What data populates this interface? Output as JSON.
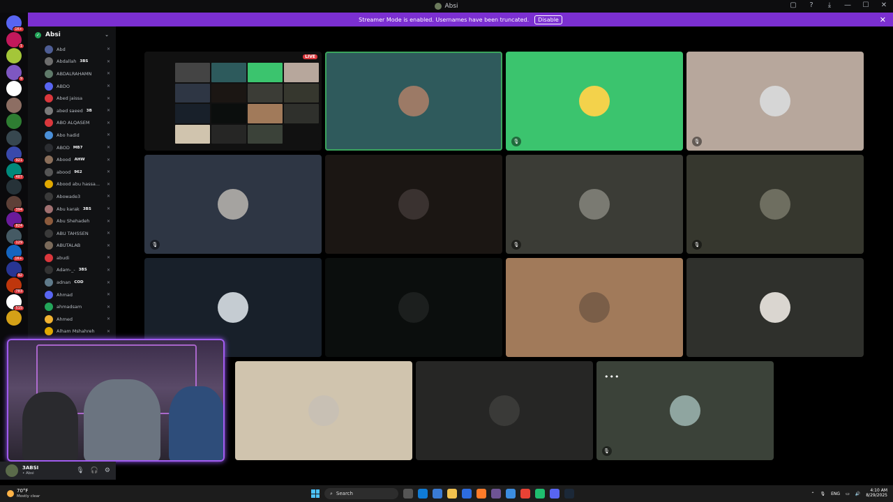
{
  "window": {
    "title": "Absi",
    "controls": [
      "▢",
      "?",
      "⤓",
      "—",
      "☐",
      "✕"
    ]
  },
  "banner": {
    "message": "Streamer Mode is enabled. Usernames have been truncated.",
    "disable_label": "Disable",
    "close": "✕"
  },
  "server_rail": [
    {
      "badge": "1K+",
      "color": "#5865f2"
    },
    {
      "badge": "1",
      "color": "#c2185b"
    },
    {
      "badge": "",
      "color": "#a4c639"
    },
    {
      "badge": "9",
      "color": "#7e57c2"
    },
    {
      "badge": "",
      "color": "#ffffff"
    },
    {
      "badge": "",
      "color": "#8d6e63"
    },
    {
      "badge": "",
      "color": "#2e7d32"
    },
    {
      "badge": "",
      "color": "#37474f"
    },
    {
      "badge": "921",
      "color": "#3949ab"
    },
    {
      "badge": "487",
      "color": "#00897b"
    },
    {
      "badge": "",
      "color": "#263238"
    },
    {
      "badge": "394",
      "color": "#5d4037"
    },
    {
      "badge": "824",
      "color": "#6a1b9a"
    },
    {
      "badge": "129",
      "color": "#455a64"
    },
    {
      "badge": "1K+",
      "color": "#1565c0"
    },
    {
      "badge": "92",
      "color": "#283593"
    },
    {
      "badge": "783",
      "color": "#bf360c"
    },
    {
      "badge": "515",
      "color": "#ffffff"
    },
    {
      "badge": "",
      "color": "#d4a017"
    }
  ],
  "server": {
    "name": "Absi",
    "check": "✓",
    "chevron": "⌄"
  },
  "members": [
    {
      "name": "Abd",
      "tag": "",
      "color": "#4e5d94"
    },
    {
      "name": "Abdallah",
      "tag": "3BS",
      "color": "#6d6d6d"
    },
    {
      "name": "ABDALRAHAMN",
      "tag": "",
      "color": "#5f7a6a"
    },
    {
      "name": "ABDO",
      "tag": "",
      "color": "#5865f2"
    },
    {
      "name": "Abed jaissa",
      "tag": "",
      "color": "#da373c"
    },
    {
      "name": "abed saeed",
      "tag": "3B",
      "color": "#7a7a7a"
    },
    {
      "name": "ABO ALQASEM",
      "tag": "",
      "color": "#da373c"
    },
    {
      "name": "Abo hadid",
      "tag": "",
      "color": "#4a8fd8"
    },
    {
      "name": "ABOD",
      "tag": "MB7",
      "color": "#2b2d31"
    },
    {
      "name": "Abood",
      "tag": "AHW",
      "color": "#8a6e5a"
    },
    {
      "name": "abood",
      "tag": "962",
      "color": "#555"
    },
    {
      "name": "Abood abu hassa...",
      "tag": "",
      "color": "#e0a800"
    },
    {
      "name": "Abowade3",
      "tag": "",
      "color": "#3a3a3a"
    },
    {
      "name": "Abu karak",
      "tag": "3BS",
      "color": "#a07070"
    },
    {
      "name": "Abu Shehadeh",
      "tag": "",
      "color": "#8b5a3c"
    },
    {
      "name": "ABU TAHSSEN",
      "tag": "",
      "color": "#3a3a3a"
    },
    {
      "name": "ABUTALAB",
      "tag": "",
      "color": "#7a6a5a"
    },
    {
      "name": "abudi",
      "tag": "",
      "color": "#da373c"
    },
    {
      "name": "Adam-_-",
      "tag": "3BS",
      "color": "#333"
    },
    {
      "name": "adnan",
      "tag": "COD",
      "color": "#5f7a8a"
    },
    {
      "name": "Ahmad",
      "tag": "",
      "color": "#5865f2"
    },
    {
      "name": "ahmadsam",
      "tag": "",
      "color": "#23a55a"
    },
    {
      "name": "Ahmed",
      "tag": "",
      "color": "#f0b232"
    },
    {
      "name": "Alham Mshahreh",
      "tag": "",
      "color": "#e0a800"
    }
  ],
  "user": {
    "name": "3ABSI",
    "status": "• Absi",
    "mic": "🎙",
    "headset": "🎧",
    "settings": "⚙"
  },
  "tiles": [
    {
      "kind": "screen",
      "bg": "#111",
      "live": "LIVE"
    },
    {
      "kind": "user",
      "bg": "#2f5a5c",
      "pic": "#9c7a66",
      "mic": "",
      "speaking": true
    },
    {
      "kind": "user",
      "bg": "#3bc46e",
      "pic": "#f3d24b",
      "mic": "🎙"
    },
    {
      "kind": "user",
      "bg": "#b7a79c",
      "pic": "#d6d6d6",
      "mic": "🎙"
    },
    {
      "kind": "user",
      "bg": "#2e3644",
      "pic": "#a5a3a0",
      "mic": "🎙"
    },
    {
      "kind": "user",
      "bg": "#1b1613",
      "pic": "#3a3230",
      "mic": ""
    },
    {
      "kind": "user",
      "bg": "#3b3c36",
      "pic": "#7a7a72",
      "mic": "🎙"
    },
    {
      "kind": "user",
      "bg": "#36372e",
      "pic": "#6e6e60",
      "mic": "🎙"
    },
    {
      "kind": "user",
      "bg": "#18202a",
      "pic": "#c5ccd2",
      "mic": ""
    },
    {
      "kind": "user",
      "bg": "#0b0e0d",
      "pic": "#1c1f1e",
      "mic": ""
    },
    {
      "kind": "user",
      "bg": "#a17a5a",
      "pic": "#7a5e48",
      "mic": ""
    },
    {
      "kind": "user",
      "bg": "#2f302c",
      "pic": "#dad6d0",
      "mic": ""
    },
    {
      "kind": "user",
      "bg": "#d0c4ae",
      "pic": "#c8c0b4",
      "mic": ""
    },
    {
      "kind": "user",
      "bg": "#262625",
      "pic": "#3a3a38",
      "mic": ""
    },
    {
      "kind": "user",
      "bg": "#3b4239",
      "pic": "#8fa5a0",
      "mic": "🎙"
    }
  ],
  "more_dots": "•••",
  "taskbar": {
    "temp": "70°F",
    "weather": "Mostly clear",
    "search_placeholder": "Search",
    "lang": "ENG",
    "time": "4:10 AM",
    "date": "8/29/2025"
  }
}
